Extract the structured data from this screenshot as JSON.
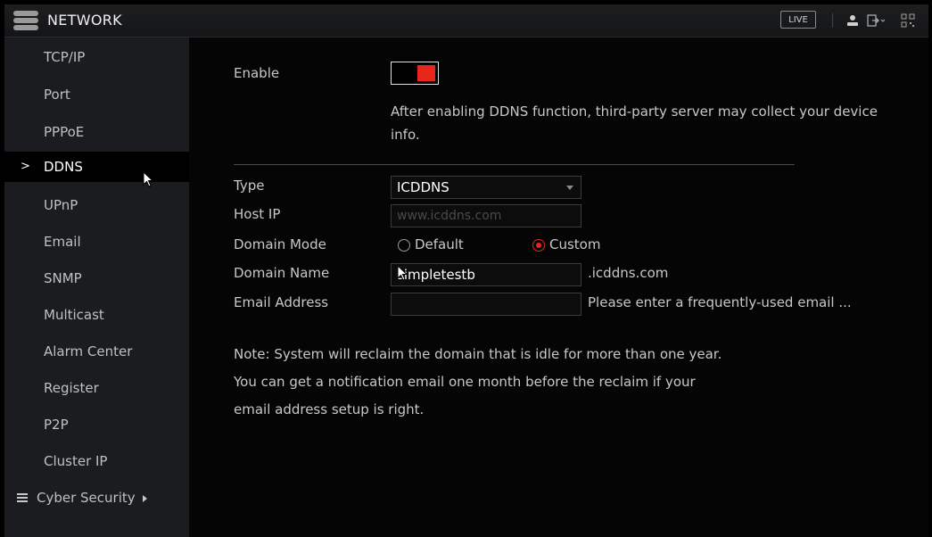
{
  "header": {
    "title": "NETWORK",
    "live_label": "LIVE",
    "icons": [
      "menu-icon",
      "user-icon",
      "logout-icon",
      "qr-code-icon"
    ]
  },
  "sidebar": {
    "items": [
      {
        "label": "TCP/IP"
      },
      {
        "label": "Port"
      },
      {
        "label": "PPPoE"
      },
      {
        "label": "DDNS",
        "active": true
      },
      {
        "label": "UPnP"
      },
      {
        "label": "Email"
      },
      {
        "label": "SNMP"
      },
      {
        "label": "Multicast"
      },
      {
        "label": "Alarm Center"
      },
      {
        "label": "Register"
      },
      {
        "label": "P2P"
      },
      {
        "label": "Cluster IP"
      },
      {
        "label": "Cyber Security",
        "has_submenu": true
      }
    ],
    "active_marker": ">"
  },
  "form": {
    "enable_label": "Enable",
    "enable_on": true,
    "enable_note": "After enabling DDNS function, third-party server may collect your device info.",
    "type_label": "Type",
    "type_value": "ICDDNS",
    "host_ip_label": "Host IP",
    "host_ip_placeholder": "www.icddns.com",
    "domain_mode_label": "Domain Mode",
    "domain_mode_options": [
      "Default",
      "Custom"
    ],
    "domain_mode_selected": "Custom",
    "domain_name_label": "Domain Name",
    "domain_name_value": "simpletestb",
    "domain_suffix": ".icddns.com",
    "email_label": "Email Address",
    "email_value": "",
    "email_hint": "Please enter a frequently-used email ...",
    "reclaim_note": "Note: System will reclaim the domain that is idle for more than one year. You can get a notification email one month before the reclaim if your email address setup is right."
  },
  "colors": {
    "accent": "#e8261b",
    "sidebar_bg": "#1a1c1f",
    "active_bg": "#000000"
  }
}
